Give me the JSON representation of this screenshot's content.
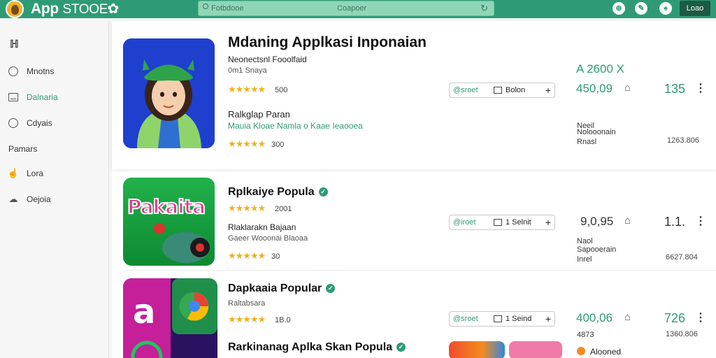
{
  "header": {
    "app_name_bold": "App",
    "app_name_thin": "STOOE",
    "search_placeholder": "Fotbdooe",
    "search_center": "Coapoer",
    "login_label": "Loao",
    "icons": [
      "avatar-icon",
      "gear-icon",
      "search-icon",
      "reload-icon",
      "globe-icon",
      "chat-icon",
      "bell-icon"
    ]
  },
  "sidebar": {
    "top_icon": "ℍ",
    "items": [
      {
        "label": "Mnotns",
        "icon": "clock-icon"
      },
      {
        "label": "Dalnaria",
        "icon": "window-icon",
        "active": true
      },
      {
        "label": "Cdyais",
        "icon": "compass-icon"
      }
    ],
    "section_label": "Pamars",
    "items2": [
      {
        "label": "Lora",
        "icon": "hand-icon"
      },
      {
        "label": "Oejoia",
        "icon": "cloud-icon"
      }
    ]
  },
  "main": {
    "more_label": "···",
    "rows": [
      {
        "title": "Mdaning Applkasi Inponaian",
        "subtitle": "Neonectsnl Fooolfaid",
        "small": "0m1 Snaya",
        "rating_1": "500",
        "section2_title": "Ralkglap Paran",
        "section2_link": "Mauia Kloae  Namla o Kaae Ieaooea",
        "rating_2": "300",
        "action_tag": "@sroet",
        "action_label": "Bolon",
        "action_plus": "+",
        "price_1": "A 2600 X",
        "price_2": "450,09",
        "count": "135",
        "meta_1": "Neeil",
        "meta_2": "Nolooonain",
        "meta_3": "Rnasl",
        "size": "1263.806"
      },
      {
        "title": "Rplkaiye Popula",
        "rating_1": "2001",
        "sub": "Rlaklarakn Bajaan",
        "small": "Gaeer Wooonai Blaoaa",
        "rating_2": "30",
        "action_tag": "@iroet",
        "action_label": "1 Selnit",
        "action_plus": "+",
        "price_2": "9,0,95",
        "count": "1.1.",
        "meta_1": "Naol",
        "meta_2": "Sapooerain",
        "meta_3": "Inrel",
        "size": "6627.804",
        "thumb_text": "Pakaita"
      },
      {
        "title": "Dapkaaia Popular",
        "small": "Raltabsara",
        "rating_2": "1B.0",
        "action_tag": "@sroet",
        "action_label": "1 Seind",
        "action_plus": "+",
        "price_2": "400,06",
        "count": "726",
        "meta_2": "4873",
        "size": "1360.806",
        "thumb_text": "a"
      },
      {
        "title": "Rarkinanag Aplka Skan Popula",
        "badge_label": "Alooned"
      }
    ]
  },
  "colors": {
    "brand": "#2e9b76",
    "star": "#f2b01e"
  }
}
